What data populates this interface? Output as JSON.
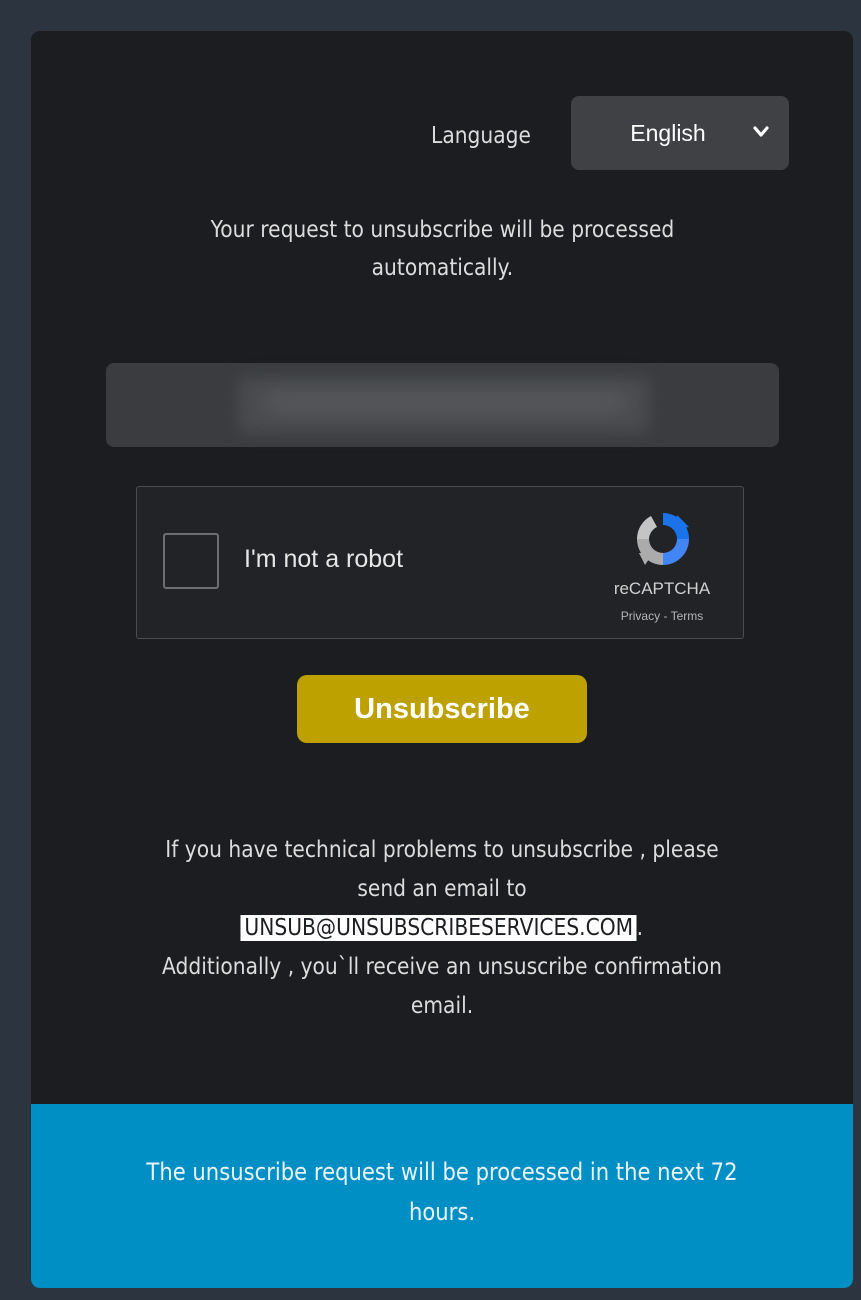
{
  "language": {
    "label": "Language",
    "selected": "English"
  },
  "intro": {
    "line1": "Your request to unsubscribe will be processed",
    "line2": "automatically."
  },
  "captcha": {
    "label": "I'm not a robot",
    "brand": "reCAPTCHA",
    "privacy": "Privacy",
    "separator": " - ",
    "terms": "Terms"
  },
  "button": {
    "label": "Unsubscribe"
  },
  "help": {
    "line1": "If you have technical problems to unsubscribe , please",
    "line2": "send an email to",
    "email": "UNSUB@UNSUBSCRIBESERVICES.COM",
    "email_suffix": ".",
    "line4": "Additionally , you`ll receive an unsuscribe confirmation",
    "line5": "email."
  },
  "footer": {
    "line1": "The unsuscribe request will be processed in the next 72",
    "line2": "hours."
  },
  "colors": {
    "button": "#bda100",
    "footer": "#008fc4"
  }
}
